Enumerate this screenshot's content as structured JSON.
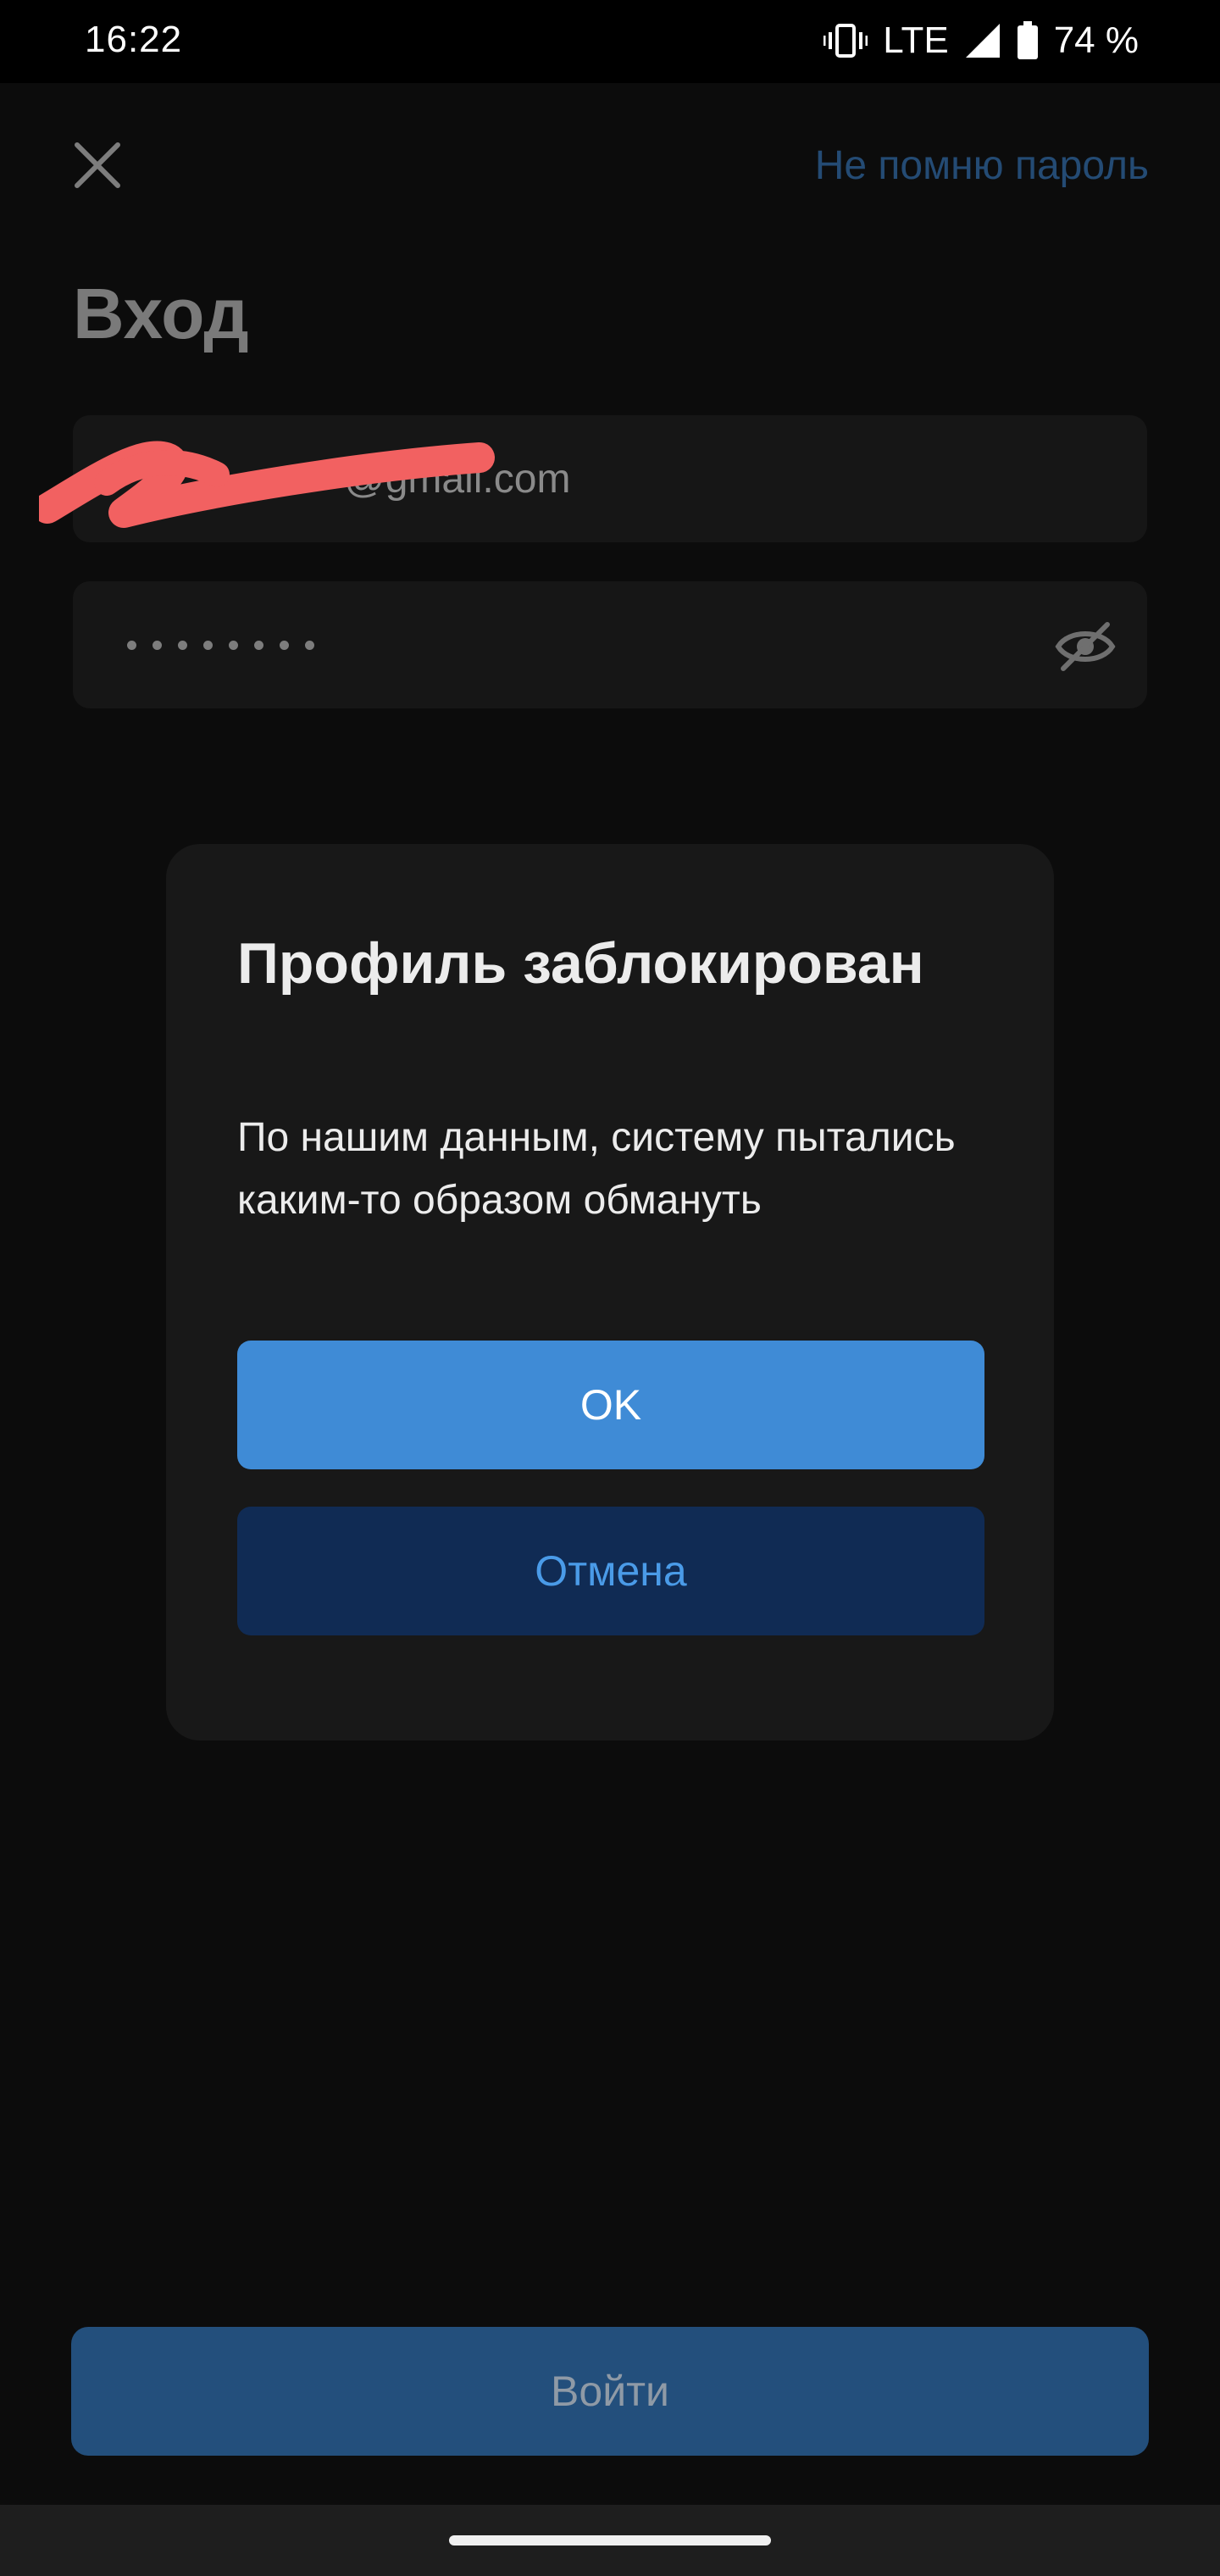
{
  "status_bar": {
    "time": "16:22",
    "network": "LTE",
    "battery": "74 %",
    "icons": [
      "vibrate-icon",
      "signal-icon",
      "battery-icon"
    ]
  },
  "login": {
    "close_icon": "close-icon",
    "forgot_password": "Не помню пароль",
    "title": "Вход",
    "email_value": "@gmail.com",
    "password_dots": 8,
    "eye_icon": "eye-off-icon",
    "submit_label": "Войти"
  },
  "dialog": {
    "title": "Профиль заблокирован",
    "message": "По нашим данным, систему пытались каким-то образом обмануть",
    "ok_label": "OK",
    "cancel_label": "Отмена"
  },
  "colors": {
    "background": "#0c0c0c",
    "dialog_background": "#181818",
    "accent": "#3f8bd6",
    "secondary_button": "#102b54",
    "link": "#244b74",
    "redaction": "#f26161"
  }
}
